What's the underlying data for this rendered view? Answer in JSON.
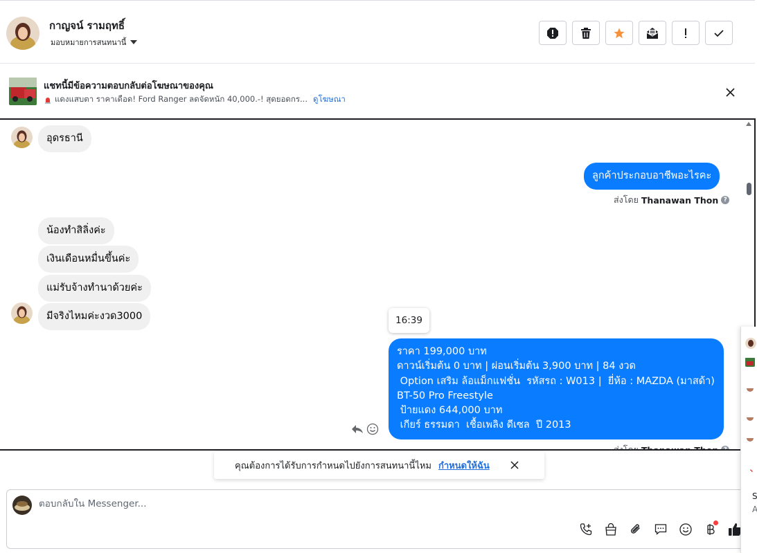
{
  "header": {
    "contact_name": "กาญจน์ รามฤทธิ์",
    "assign_label": "มอบหมายการสนทนานี้",
    "actions": [
      {
        "name": "spam-button",
        "icon": "alert-octagon-icon"
      },
      {
        "name": "delete-button",
        "icon": "trash-icon"
      },
      {
        "name": "star-button",
        "icon": "star-icon",
        "color": "#f7923b"
      },
      {
        "name": "mark-unread-button",
        "icon": "envelope-open-icon"
      },
      {
        "name": "follow-up-button",
        "icon": "exclamation-icon"
      },
      {
        "name": "mark-done-button",
        "icon": "check-icon"
      }
    ]
  },
  "ad_reply": {
    "title": "แชทนี้มีข้อความตอบกลับต่อโฆษณาของคุณ",
    "snippet": "แดงแสบตา ราคาเดือด! Ford Ranger ลดจัดหนัก 40,000.-! สุดยอดกร...",
    "link": "ดูโฆษณา"
  },
  "messages": {
    "m1": "อุดรธานี",
    "m2": "ลูกค้าประกอบอาชีพอะไรคะ",
    "sent_by_1": {
      "prefix": "ส่งโดย",
      "name": "Thanawan Thon"
    },
    "m3": "น้องทำสิลิ่งค่ะ",
    "m4": "เงินเดือนหมื่นขึ้นค่ะ",
    "m5": "แม่รับจ้างทำนาด้วยค่ะ",
    "m6": "มีจริงไหมค่ะงวด3000",
    "timestamp": "16:39",
    "m7_lines": [
      "ราคา 199,000 บาท",
      "ดาวน์เริ่มต้น 0 บาท | ผ่อนเริ่มต้น 3,900 บาท | 84 งวด",
      " Option เสริม ล้อแม็กแฟชั่น  รหัสรถ : W013 |  ยี่ห้อ : MAZDA (มาสด้า)",
      "BT-50 Pro Freestyle",
      " ป้ายแดง 644,000 บาท",
      " เกียร์ ธรรมดา  เชื้อเพลิง ดีเซล  ปี 2013"
    ],
    "sent_by_2": {
      "prefix": "ส่งโดย",
      "name": "Thanawan Thon"
    }
  },
  "assign_prompt": {
    "text": "คุณต้องการได้รับการกำหนดไปยังการสนทนานี้ไหม",
    "link": "กำหนดให้ฉัน"
  },
  "composer": {
    "placeholder": "ตอบกลับใน Messenger..."
  },
  "side_widget": {
    "letter_1": "S",
    "letter_2": "A"
  },
  "colors": {
    "outgoing_bubble": "#0a7cff",
    "incoming_bubble": "#f0f0f0",
    "link": "#216fdb",
    "star": "#f7923b",
    "like": "#1c1e21"
  }
}
